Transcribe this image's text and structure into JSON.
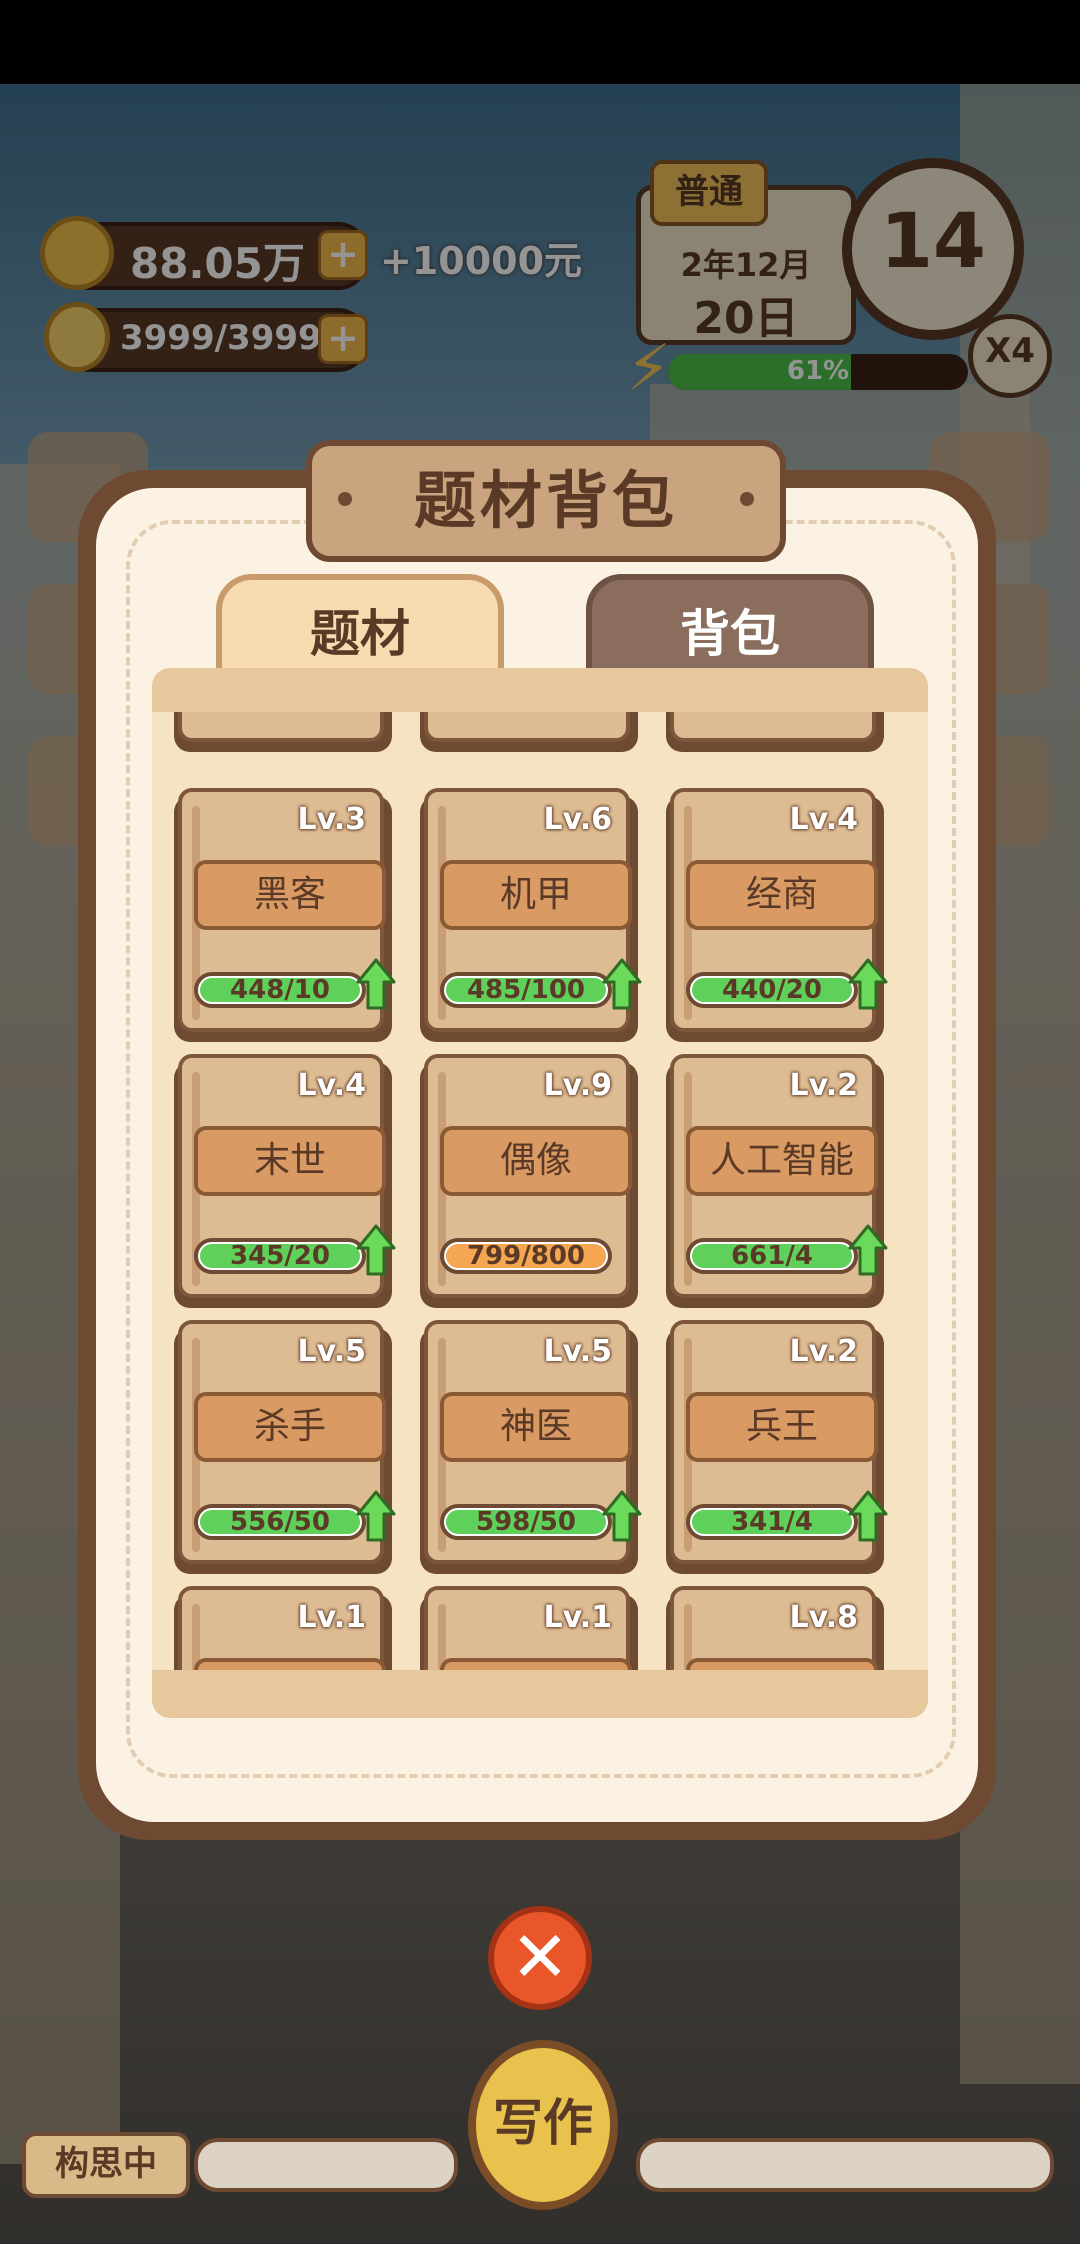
{
  "hud": {
    "money": "88.05万",
    "income": "+10000元",
    "inspiration": "3999/3999",
    "difficulty": "普通",
    "date_line1": "2年12月",
    "date_line2": "20日",
    "clock_value": "14",
    "speed": "X4",
    "energy_percent": "61%",
    "energy_fraction": 0.61
  },
  "modal": {
    "title": "题材背包",
    "tabs": [
      {
        "label": "题材",
        "active": true
      },
      {
        "label": "背包",
        "active": false
      }
    ],
    "books": [
      {
        "level": "Lv.3",
        "name": "黑客",
        "progress": "448/10",
        "upgradable": true
      },
      {
        "level": "Lv.6",
        "name": "机甲",
        "progress": "485/100",
        "upgradable": true
      },
      {
        "level": "Lv.4",
        "name": "经商",
        "progress": "440/20",
        "upgradable": true
      },
      {
        "level": "Lv.4",
        "name": "末世",
        "progress": "345/20",
        "upgradable": true
      },
      {
        "level": "Lv.9",
        "name": "偶像",
        "progress": "799/800",
        "upgradable": false
      },
      {
        "level": "Lv.2",
        "name": "人工智能",
        "progress": "661/4",
        "upgradable": true
      },
      {
        "level": "Lv.5",
        "name": "杀手",
        "progress": "556/50",
        "upgradable": true
      },
      {
        "level": "Lv.5",
        "name": "神医",
        "progress": "598/50",
        "upgradable": true
      },
      {
        "level": "Lv.2",
        "name": "兵王",
        "progress": "341/4",
        "upgradable": true
      },
      {
        "level": "Lv.1",
        "name": "",
        "progress": "",
        "upgradable": false
      },
      {
        "level": "Lv.1",
        "name": "",
        "progress": "",
        "upgradable": false
      },
      {
        "level": "Lv.8",
        "name": "",
        "progress": "",
        "upgradable": false
      }
    ]
  },
  "bottom": {
    "status_label": "构思中",
    "write_button": "写作"
  }
}
